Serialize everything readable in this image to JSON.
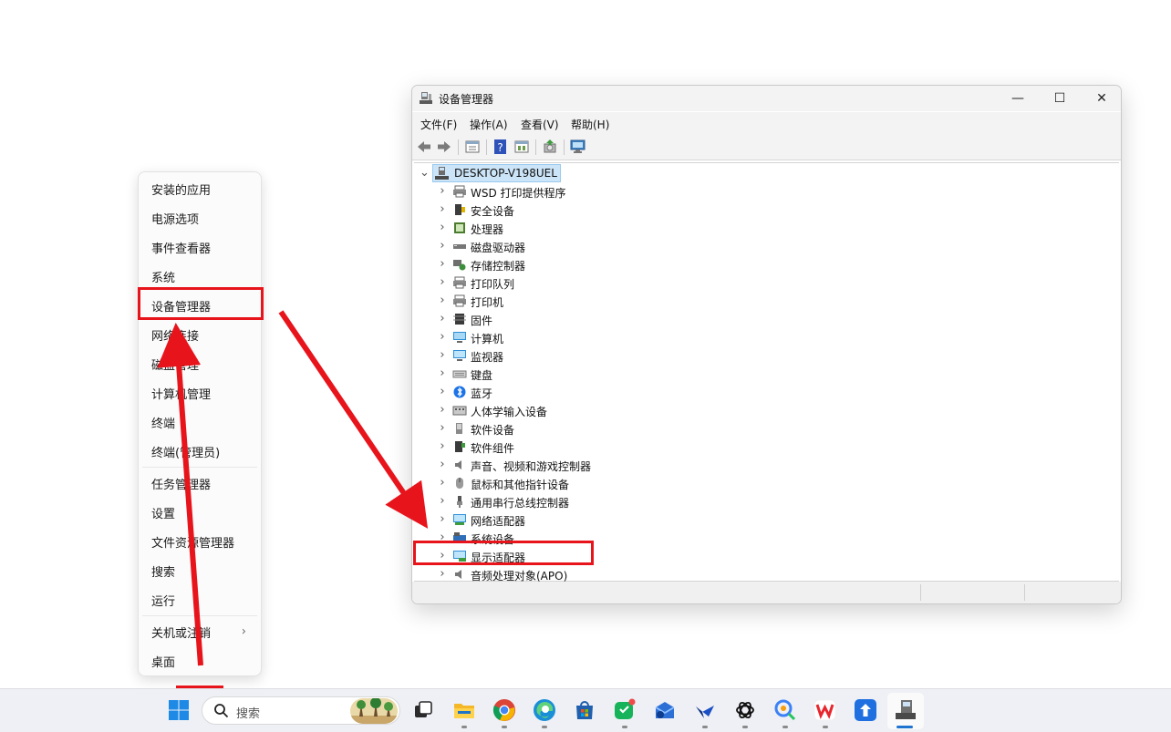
{
  "context_menu": {
    "items": [
      "安装的应用",
      "电源选项",
      "事件查看器",
      "系统",
      "设备管理器",
      "网络连接",
      "磁盘管理",
      "计算机管理",
      "终端",
      "终端(管理员)",
      "任务管理器",
      "设置",
      "文件资源管理器",
      "搜索",
      "运行",
      "关机或注销",
      "桌面"
    ],
    "submenu_chevron": "›"
  },
  "window": {
    "title": "设备管理器",
    "controls": {
      "minimize": "—",
      "maximize": "☐",
      "close": "✕"
    },
    "menu": [
      "文件(F)",
      "操作(A)",
      "查看(V)",
      "帮助(H)"
    ],
    "toolbar_icons": [
      "back-arrow-icon",
      "forward-arrow-icon",
      "properties-icon",
      "help-icon",
      "show-hidden-icon",
      "update-driver-icon",
      "scan-hardware-icon"
    ],
    "tree": {
      "root": "DESKTOP-V198UEL",
      "expanded_glyph": "⌄",
      "collapsed_glyph": "›",
      "categories": [
        {
          "label": "WSD 打印提供程序",
          "icon": "printer-icon"
        },
        {
          "label": "安全设备",
          "icon": "security-device-icon"
        },
        {
          "label": "处理器",
          "icon": "processor-icon"
        },
        {
          "label": "磁盘驱动器",
          "icon": "disk-drive-icon"
        },
        {
          "label": "存储控制器",
          "icon": "storage-controller-icon"
        },
        {
          "label": "打印队列",
          "icon": "printer-icon"
        },
        {
          "label": "打印机",
          "icon": "printer-icon"
        },
        {
          "label": "固件",
          "icon": "firmware-icon"
        },
        {
          "label": "计算机",
          "icon": "computer-icon"
        },
        {
          "label": "监视器",
          "icon": "monitor-icon"
        },
        {
          "label": "键盘",
          "icon": "keyboard-icon"
        },
        {
          "label": "蓝牙",
          "icon": "bluetooth-icon"
        },
        {
          "label": "人体学输入设备",
          "icon": "hid-icon"
        },
        {
          "label": "软件设备",
          "icon": "software-device-icon"
        },
        {
          "label": "软件组件",
          "icon": "software-component-icon"
        },
        {
          "label": "声音、视频和游戏控制器",
          "icon": "speaker-icon"
        },
        {
          "label": "鼠标和其他指针设备",
          "icon": "mouse-icon"
        },
        {
          "label": "通用串行总线控制器",
          "icon": "usb-icon"
        },
        {
          "label": "网络适配器",
          "icon": "network-adapter-icon"
        },
        {
          "label": "系统设备",
          "icon": "system-device-icon"
        },
        {
          "label": "显示适配器",
          "icon": "display-adapter-icon"
        },
        {
          "label": "音频处理对象(APO)",
          "icon": "speaker-icon"
        }
      ]
    }
  },
  "annotations": {
    "color": "#e8141c",
    "highlighted_menu_item": "设备管理器",
    "highlighted_tree_item": "显示适配器"
  },
  "taskbar": {
    "search_placeholder": "搜索",
    "apps": [
      "start-icon",
      "task-view-icon",
      "file-explorer-icon",
      "chrome-icon",
      "edge-icon",
      "microsoft-store-icon",
      "chat-app-icon",
      "mail-app-icon",
      "feishu-icon",
      "chatgpt-icon",
      "search-assistant-icon",
      "wps-icon",
      "upload-app-icon",
      "device-manager-app-icon"
    ]
  }
}
